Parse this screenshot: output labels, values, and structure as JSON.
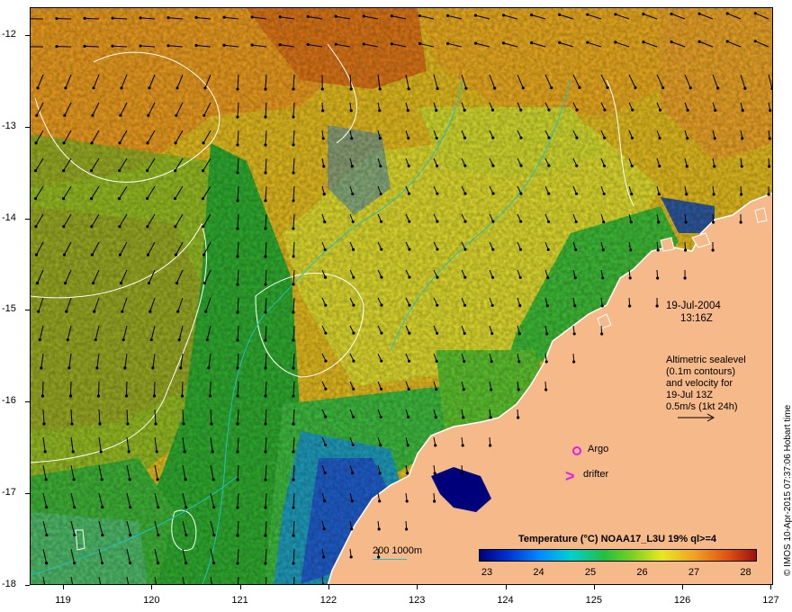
{
  "map": {
    "date": "19-Jul-2004",
    "time": "13:16Z",
    "altimetry_note": [
      "Altimetric sealevel",
      "(0.1m contours)",
      "and velocity for",
      "19-Jul 13Z",
      "0.5m/s (1kt 24h)"
    ],
    "argo_label": "Argo",
    "drifter_label": "drifter",
    "depth_contours_label": "200  1000m",
    "credit": "© IMOS 10-Apr-2015 07:37:06 Hobart time",
    "latitudes": [
      "-12",
      "-13",
      "-14",
      "-15",
      "-16",
      "-17",
      "-18"
    ],
    "longitudes": [
      "119",
      "120",
      "121",
      "122",
      "123",
      "124",
      "125",
      "126",
      "127"
    ],
    "land_color": "#f5b98a",
    "argo_color": "#e020e0",
    "contour_color": "#ffffff",
    "bathymetry_color": "#20c0c0"
  },
  "legend": {
    "title": "Temperature (°C) NOAA17_L3U 19% ql>=4",
    "ticks": [
      "23",
      "24",
      "25",
      "26",
      "27",
      "28"
    ],
    "colormap": [
      "#00007a",
      "#0030d0",
      "#008cff",
      "#00d0d0",
      "#20c040",
      "#78d020",
      "#e8e820",
      "#f0a020",
      "#e05010",
      "#a01010"
    ]
  }
}
